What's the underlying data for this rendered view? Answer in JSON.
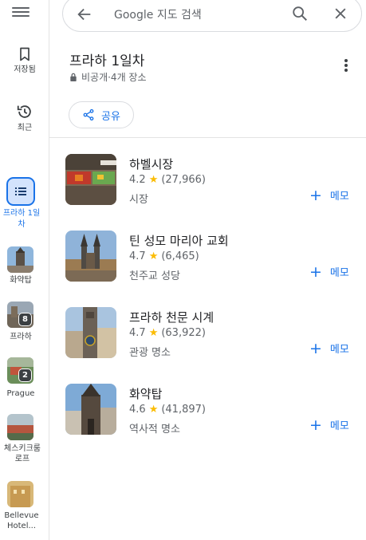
{
  "search": {
    "placeholder": "Google 지도 검색"
  },
  "rail": {
    "saved_label": "저장됨",
    "recent_label": "최근",
    "active_list_label": "프라하 1일차",
    "lists": [
      {
        "label": "화약탑",
        "badge": ""
      },
      {
        "label": "프라하",
        "badge": "8"
      },
      {
        "label": "Prague",
        "badge": "2"
      },
      {
        "label": "체스키크룸로프",
        "badge": ""
      },
      {
        "label": "Bellevue Hotel...",
        "badge": ""
      }
    ]
  },
  "header": {
    "title": "프라하 1일차",
    "meta": "비공개·4개 장소",
    "share_label": "공유"
  },
  "places": [
    {
      "name": "하벨시장",
      "rating": "4.2",
      "reviews": "(27,966)",
      "category": "시장",
      "memo": "메모"
    },
    {
      "name": "틴 성모 마리아 교회",
      "rating": "4.7",
      "reviews": "(6,465)",
      "category": "천주교 성당",
      "memo": "메모"
    },
    {
      "name": "프라하 천문 시계",
      "rating": "4.7",
      "reviews": "(63,922)",
      "category": "관광 명소",
      "memo": "메모"
    },
    {
      "name": "화약탑",
      "rating": "4.6",
      "reviews": "(41,897)",
      "category": "역사적 명소",
      "memo": "메모"
    }
  ],
  "colors": {
    "accent": "#1a73e8",
    "star": "#fbbc04",
    "active_bg": "#d3e3fd"
  }
}
